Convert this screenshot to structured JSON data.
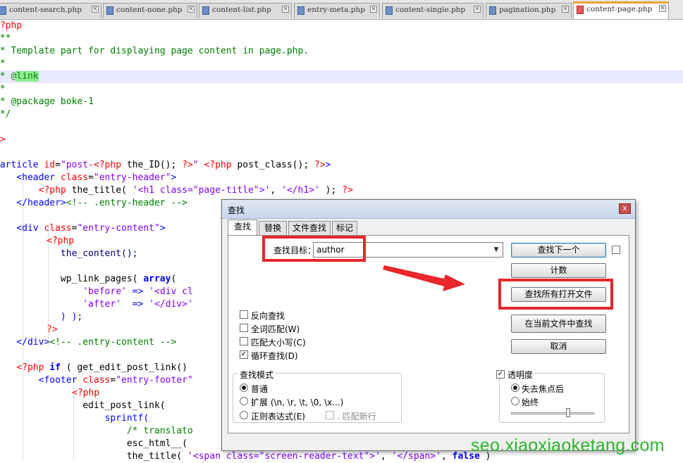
{
  "tabs": [
    {
      "label": "content-search.php"
    },
    {
      "label": "content-none.php"
    },
    {
      "label": "content-list.php"
    },
    {
      "label": "entry-meta.php"
    },
    {
      "label": "content-single.php"
    },
    {
      "label": "pagination.php"
    },
    {
      "label": "content-page.php"
    }
  ],
  "code": {
    "l1": "<?php",
    "l2": "/**",
    "l3": " * Template part for displaying page content in page.php.",
    "l4": " *",
    "l5a": " * @",
    "l5b": "link",
    "l6": " *",
    "l7": " * @package boke-1",
    "l8": " */",
    "l9": "?>",
    "l10": {
      "a": "<article ",
      "b": "id",
      "c": "=",
      "d": "\"post-",
      "e": "<?php",
      "f": " the_ID(); ",
      "g": "?>",
      "h": "\"",
      "i": " ",
      "j": "<?php",
      "k": " post_class(); ",
      "l": "?>",
      "m": ">"
    },
    "l11": {
      "a": "    <header ",
      "b": "class",
      "c": "=",
      "d": "\"entry-header\"",
      "e": ">"
    },
    "l12": {
      "a": "        ",
      "b": "<?php",
      "c": " the_title( ",
      "d": "'<h1 class=\"page-title\">'",
      "e": ", ",
      "f": "'</h1>'",
      "g": " ); ",
      "h": "?>"
    },
    "l13": {
      "a": "    </header>",
      "b": "<!-- .entry-header -->"
    },
    "l14": {
      "a": "    <div ",
      "b": "class",
      "c": "=",
      "d": "\"entry-content\"",
      "e": ">"
    },
    "l15": "<?php",
    "l16": "            the_content();",
    "l17": {
      "a": "            wp_link_pages( ",
      "b": "array",
      "c": "("
    },
    "l18": {
      "a": "                ",
      "b": "'before'",
      "c": " => ",
      "d": "'<div cl"
    },
    "l19": {
      "a": "                ",
      "b": "'after'",
      "c": "  => ",
      "d": "'</div>'"
    },
    "l20": "            ) );",
    "l21": "?>",
    "l22": {
      "a": "    </div>",
      "b": "<!-- .entry-content -->"
    },
    "l23": {
      "a": "    ",
      "b": "<?php",
      "c": " ",
      "d": "if",
      "e": " ( get_edit_post_link()"
    },
    "l24": {
      "a": "        <footer ",
      "b": "class",
      "c": "=",
      "d": "\"entry-footer\""
    },
    "l25": "<?php",
    "l26": "                edit_post_link(",
    "l27": "                    sprintf(",
    "l28": "                        /* translato",
    "l29": "                        esc_html__( ",
    "l30": {
      "a": "                        the_title( ",
      "b": "'<span class=\"screen-reader-text\">'",
      "c": ", ",
      "d": "'</span>'",
      "e": ", ",
      "f": "false",
      "g": " )"
    }
  },
  "dialog": {
    "title": "查找",
    "close_glyph": "x",
    "tabs": [
      {
        "label": "查找"
      },
      {
        "label": "替换"
      },
      {
        "label": "文件查找"
      },
      {
        "label": "标记"
      }
    ],
    "find_label": "查找目标：",
    "find_value": "author",
    "buttons": {
      "find_next": "查找下一个",
      "count": "计数",
      "find_all_open": "查找所有打开文件",
      "find_in_current": "在当前文件中查找",
      "cancel": "取消"
    },
    "options": [
      {
        "label": "反向查找",
        "checked": false
      },
      {
        "label": "全词匹配(W)",
        "checked": false
      },
      {
        "label": "匹配大小写(C)",
        "checked": false
      },
      {
        "label": "循环查找(D)",
        "checked": true
      }
    ],
    "search_mode": {
      "title": "查找模式",
      "normal": "普通",
      "extended": "扩展 (\\n, \\r, \\t, \\0, \\x...)",
      "regex": "正则表达式(E)",
      "newline": ". 匹配新行",
      "selected": "normal"
    },
    "transparency": {
      "title": "透明度",
      "checked": true,
      "on_lose_focus": "失去焦点后",
      "always": "始终",
      "selected": "on_lose_focus",
      "level": 0.7
    },
    "check_mark": "✓"
  },
  "watermark": "seo.xiaoxiaoketang.com",
  "colors": {
    "annotation": "#e8262b",
    "watermark": "#2ab52a",
    "tab_accent": "#f0a030"
  }
}
